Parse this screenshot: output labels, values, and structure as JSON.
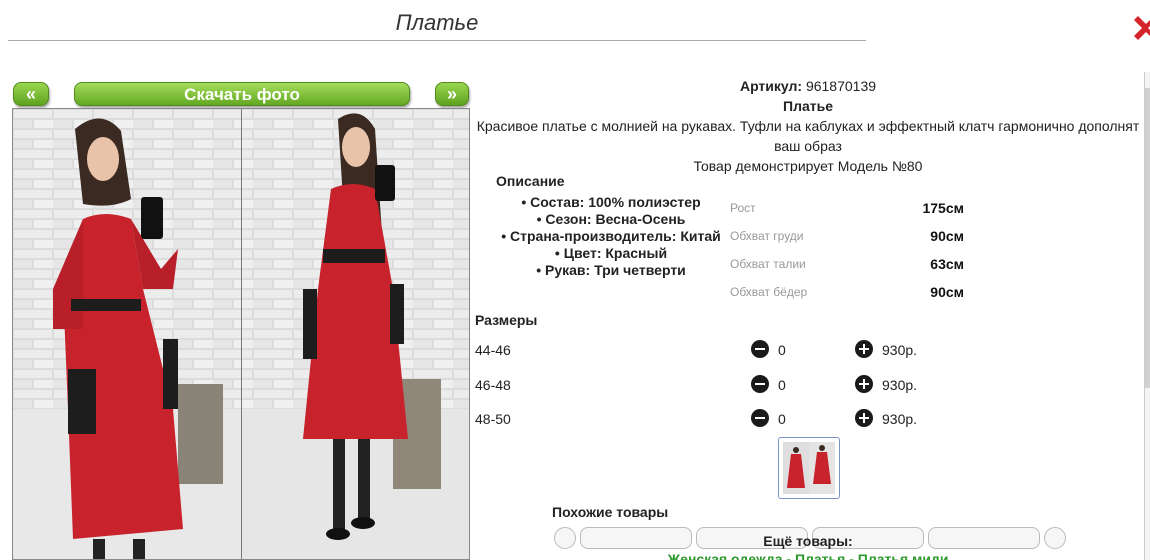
{
  "page": {
    "title": "Платье"
  },
  "gallery": {
    "prev_label": "«",
    "download_label": "Скачать фото",
    "next_label": "»"
  },
  "product": {
    "article_label": "Артикул:",
    "article_value": "961870139",
    "name": "Платье",
    "description_line1": "Красивое платье с молнией на рукавах. Туфли на каблуках и эффектный клатч гармонично дополнят",
    "description_line2": "ваш образ",
    "model_note": "Товар демонстрирует Модель №80"
  },
  "specs": {
    "heading": "Описание",
    "items": [
      "Состав: 100% полиэстер",
      "Сезон: Весна-Осень",
      "Страна-производитель: Китай",
      "Цвет: Красный",
      "Рукав: Три четверти"
    ]
  },
  "model_measures": [
    {
      "label": "Рост",
      "value": "175см"
    },
    {
      "label": "Обхват груди",
      "value": "90см"
    },
    {
      "label": "Обхват талии",
      "value": "63см"
    },
    {
      "label": "Обхват бёдер",
      "value": "90см"
    }
  ],
  "sizes": {
    "heading": "Размеры",
    "rows": [
      {
        "size": "44-46",
        "qty": "0",
        "price": "930р."
      },
      {
        "size": "46-48",
        "qty": "0",
        "price": "930р."
      },
      {
        "size": "48-50",
        "qty": "0",
        "price": "930р."
      }
    ]
  },
  "similar": {
    "heading": "Похожие товары"
  },
  "more": {
    "heading": "Ещё товары:",
    "links": "Женская одежда - Платья - Платья миди"
  },
  "colors": {
    "accent_green": "#6cb02b",
    "dress_red": "#c8232c",
    "link_green": "#2e9a2e"
  }
}
